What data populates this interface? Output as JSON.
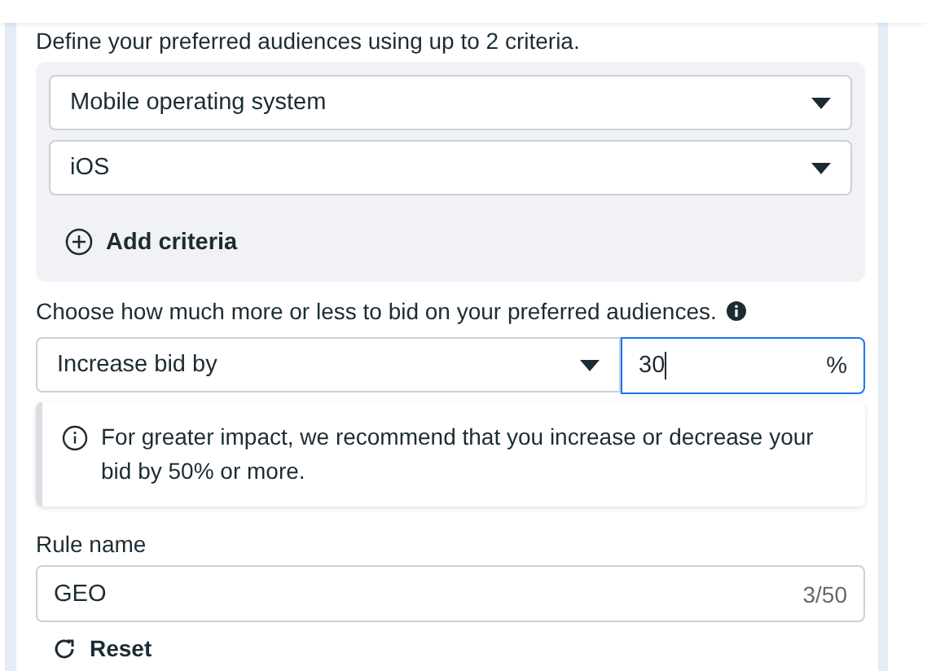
{
  "intro": "Define your preferred audiences using up to 2 criteria.",
  "criteria": [
    {
      "value": "Mobile operating system"
    },
    {
      "value": "iOS"
    }
  ],
  "add_criteria": "Add criteria",
  "bid_label": "Choose how much more or less to bid on your preferred audiences.",
  "bid_select": {
    "value": "Increase bid by"
  },
  "bid_input": {
    "value": "30",
    "unit": "%",
    "focused": true
  },
  "notice": "For greater impact, we recommend that you increase or decrease your bid by 50% or more.",
  "rule_name": {
    "label": "Rule name",
    "value": "GEO",
    "counter": "3/50"
  },
  "reset": "Reset"
}
